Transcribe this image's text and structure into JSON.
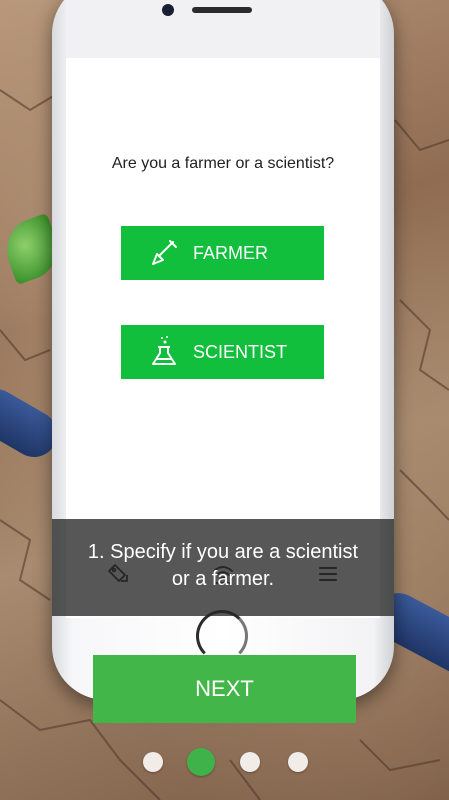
{
  "screen": {
    "question": "Are you a farmer or a scientist?",
    "choices": [
      {
        "label": "FARMER",
        "icon": "shovel-icon"
      },
      {
        "label": "SCIENTIST",
        "icon": "flask-icon"
      }
    ]
  },
  "tabbar": {
    "items": [
      {
        "icon": "tag-icon"
      },
      {
        "icon": "wireless-icon"
      },
      {
        "icon": "menu-icon"
      }
    ]
  },
  "overlay": {
    "line1": "1. Specify if you are a scientist",
    "line2": "or a farmer."
  },
  "next_label": "NEXT",
  "pagination": {
    "current": 2,
    "total": 4
  },
  "colors": {
    "choice_button": "#11bf3c",
    "next_button": "#43b649",
    "active_dot": "#3fb34a"
  }
}
